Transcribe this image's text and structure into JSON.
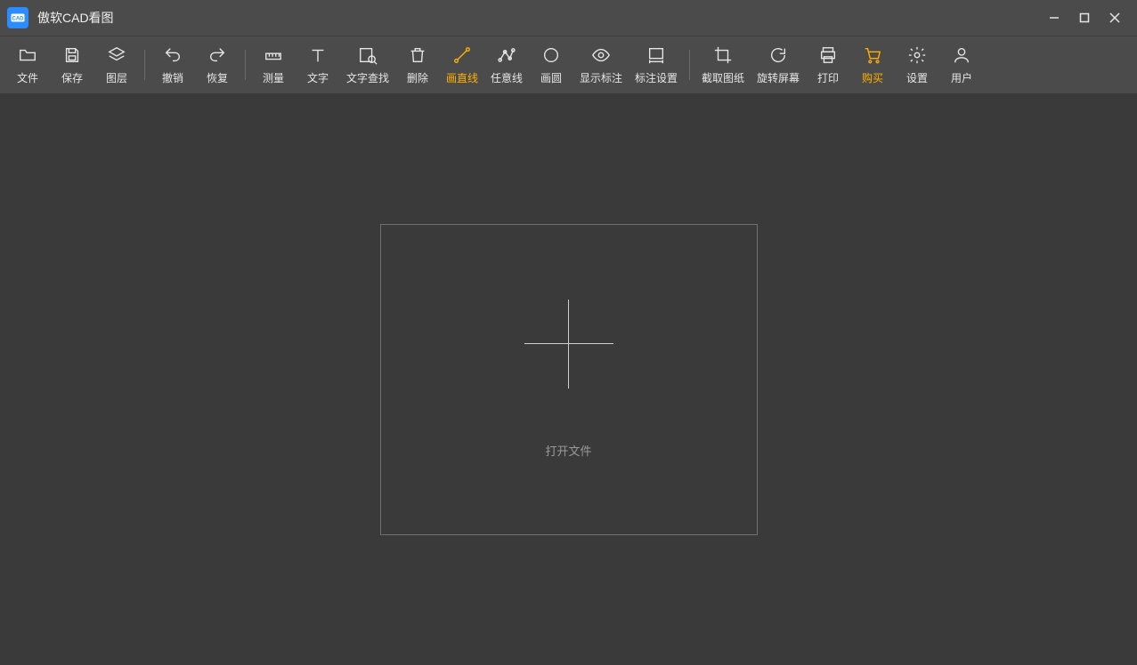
{
  "titlebar": {
    "title": "傲软CAD看图"
  },
  "toolbar": {
    "file": "文件",
    "save": "保存",
    "layers": "图层",
    "undo": "撤销",
    "redo": "恢复",
    "measure": "测量",
    "text": "文字",
    "find_text": "文字查找",
    "delete": "删除",
    "line": "画直线",
    "polyline": "任意线",
    "circle": "画圆",
    "show_annot": "显示标注",
    "annot_settings": "标注设置",
    "crop": "截取图纸",
    "rotate": "旋转屏幕",
    "print": "打印",
    "buy": "购买",
    "settings": "设置",
    "user": "用户"
  },
  "canvas": {
    "open_label": "打开文件"
  },
  "colors": {
    "accent": "#ffb000",
    "logo": "#2a8cff"
  }
}
